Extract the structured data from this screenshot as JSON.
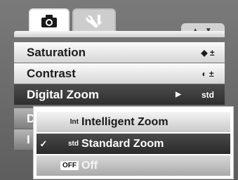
{
  "tabs": {
    "camera_icon": "camera-icon",
    "setup_icon": "wrench-icon",
    "scroll_indicator": "▲ ▼"
  },
  "menu": {
    "items": [
      {
        "label": "Saturation",
        "value": "◆ ±",
        "icon": "saturation-icon"
      },
      {
        "label": "Contrast",
        "value": "◐ ±",
        "icon": "contrast-icon"
      },
      {
        "label": "Digital Zoom",
        "arrow": "▶",
        "value": "std",
        "icon": "standard-zoom-icon"
      },
      {
        "label": "D"
      },
      {
        "label": "I"
      }
    ]
  },
  "submenu": {
    "items": [
      {
        "label": "Intelligent Zoom",
        "icon_text": "Int",
        "checked": ""
      },
      {
        "label": "Standard Zoom",
        "icon_text": "std",
        "checked": "✓"
      },
      {
        "label": "Off",
        "icon_text": "OFF",
        "checked": ""
      }
    ]
  },
  "colors": {
    "selected_row": "#3a3a3a",
    "light_row": "#e8e8e8"
  }
}
